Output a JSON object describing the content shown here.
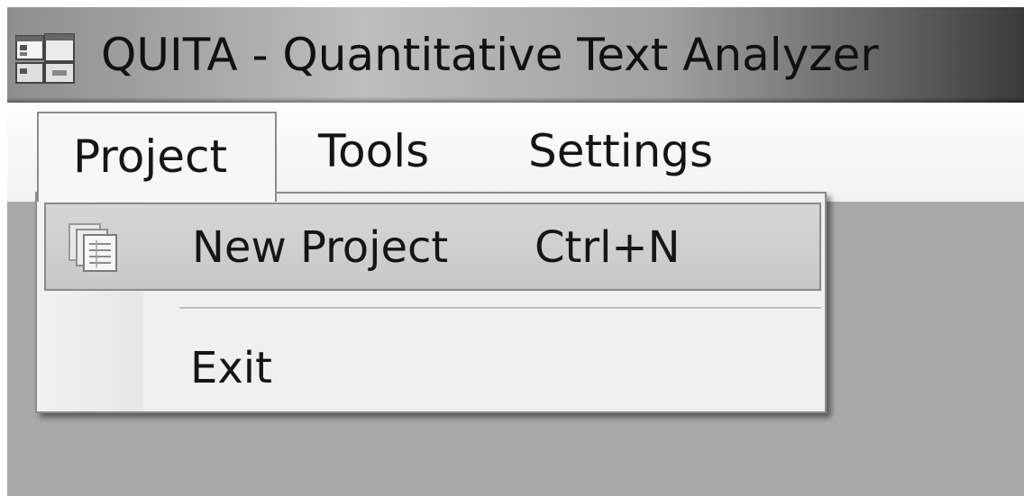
{
  "window": {
    "title": "QUITA - Quantitative Text Analyzer"
  },
  "icons": {
    "app": "application-window-icon",
    "new_project": "new-document-stack-icon"
  },
  "menubar": {
    "items": [
      {
        "label": "Project",
        "open": true
      },
      {
        "label": "Tools"
      },
      {
        "label": "Settings"
      }
    ]
  },
  "dropdown": {
    "items": [
      {
        "label": "New Project",
        "shortcut": "Ctrl+N",
        "highlighted": true
      },
      {
        "label": "Exit"
      }
    ]
  },
  "colors": {
    "menu_highlight": "#cdcdcd",
    "workspace": "#a9a9a9",
    "menubar": "#f5f5f5"
  }
}
